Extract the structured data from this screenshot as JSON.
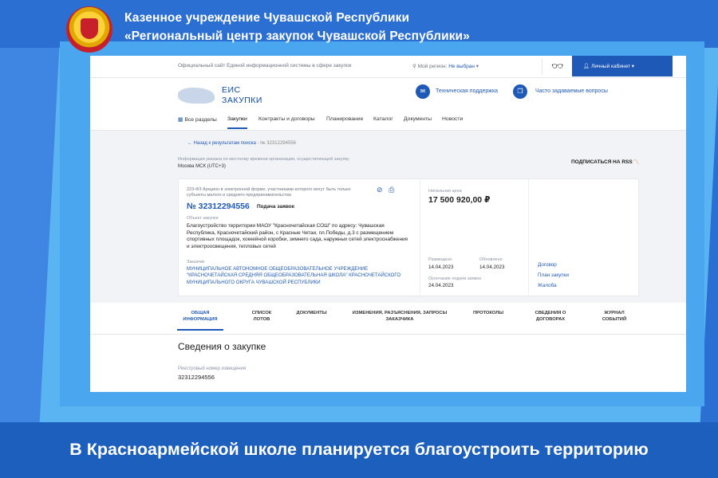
{
  "header": {
    "line1": "Казенное учреждение Чувашской Республики",
    "line2": "«Региональный центр закупок Чувашской Республики»"
  },
  "site": {
    "topbar_text": "Официальный сайт Единой информационной системы в сфере закупок",
    "region_label": "Мой регион:",
    "region_value": "Не выбран",
    "cabinet": "Личный кабинет",
    "logo_line1": "ЕИС",
    "logo_line2": "ЗАКУПКИ",
    "support": "Техническая поддержка",
    "faq": "Часто задаваемые вопросы",
    "nav": [
      "Все разделы",
      "Закупки",
      "Контракты и договоры",
      "Планирование",
      "Каталог",
      "Документы",
      "Новости"
    ],
    "breadcrumb_back": "Назад к результатам поиска",
    "breadcrumb_current": "№ 32312294556",
    "tz_note": "Информация указана по местному времени организации, осуществляющей закупку",
    "tz_value": "Москва МСК (UTC+3)",
    "rss": "ПОДПИСАТЬСЯ НА RSS"
  },
  "card": {
    "law": "223-ФЗ Аукцион в электронной форме, участниками которого могут быть только субъекты малого и среднего предпринимательства",
    "number": "№ 32312294556",
    "stage": "Подача заявок",
    "object_label": "Объект закупки",
    "object": "Благоустройство территории МАОУ \"Красночетайская СОШ\" по адресу: Чувашская Республика, Красночетайский район, с Красные Четаи, пл.Победы, д.3 с размещением спортивных площадок, хоккейной коробки, зимнего сада, наружных сетей электроснабжения и электроосвещения, тепловых сетей",
    "customer_label": "Заказчик",
    "customer": "МУНИЦИПАЛЬНОЕ АВТОНОМНОЕ ОБЩЕОБРАЗОВАТЕЛЬНОЕ УЧРЕЖДЕНИЕ \"КРАСНОЧЕТАЙСКАЯ СРЕДНЯЯ ОБЩЕОБРАЗОВАТЕЛЬНАЯ ШКОЛА\" КРАСНОЧЕТАЙСКОГО МУНИЦИПАЛЬНОГО ОКРУГА ЧУВАШСКОЙ РЕСПУБЛИКИ",
    "price_label": "Начальная цена",
    "price": "17 500 920,00 ₽",
    "placed_label": "Размещено",
    "placed": "14.04.2023",
    "updated_label": "Обновлено",
    "updated": "14.04.2023",
    "deadline_label": "Окончание подачи заявок",
    "deadline": "24.04.2023",
    "links": [
      "Договор",
      "План закупки",
      "Жалоба"
    ]
  },
  "tabs": [
    "ОБЩАЯ ИНФОРМАЦИЯ",
    "СПИСОК ЛОТОВ",
    "ДОКУМЕНТЫ",
    "ИЗМЕНЕНИЯ, РАЗЪЯСНЕНИЯ, ЗАПРОСЫ ЗАКАЗЧИКА",
    "ПРОТОКОЛЫ",
    "СВЕДЕНИЯ О ДОГОВОРАХ",
    "ЖУРНАЛ СОБЫТИЙ"
  ],
  "info": {
    "title": "Сведения о закупке",
    "reg_label": "Реестровый номер извещения",
    "reg_value": "32312294556"
  },
  "caption": "В Красноармейской школе планируется благоустроить территорию",
  "colors": {
    "brand_blue": "#1f59b8",
    "frame_blue": "#5ab4f2",
    "background_blue": "#1e63c4"
  }
}
